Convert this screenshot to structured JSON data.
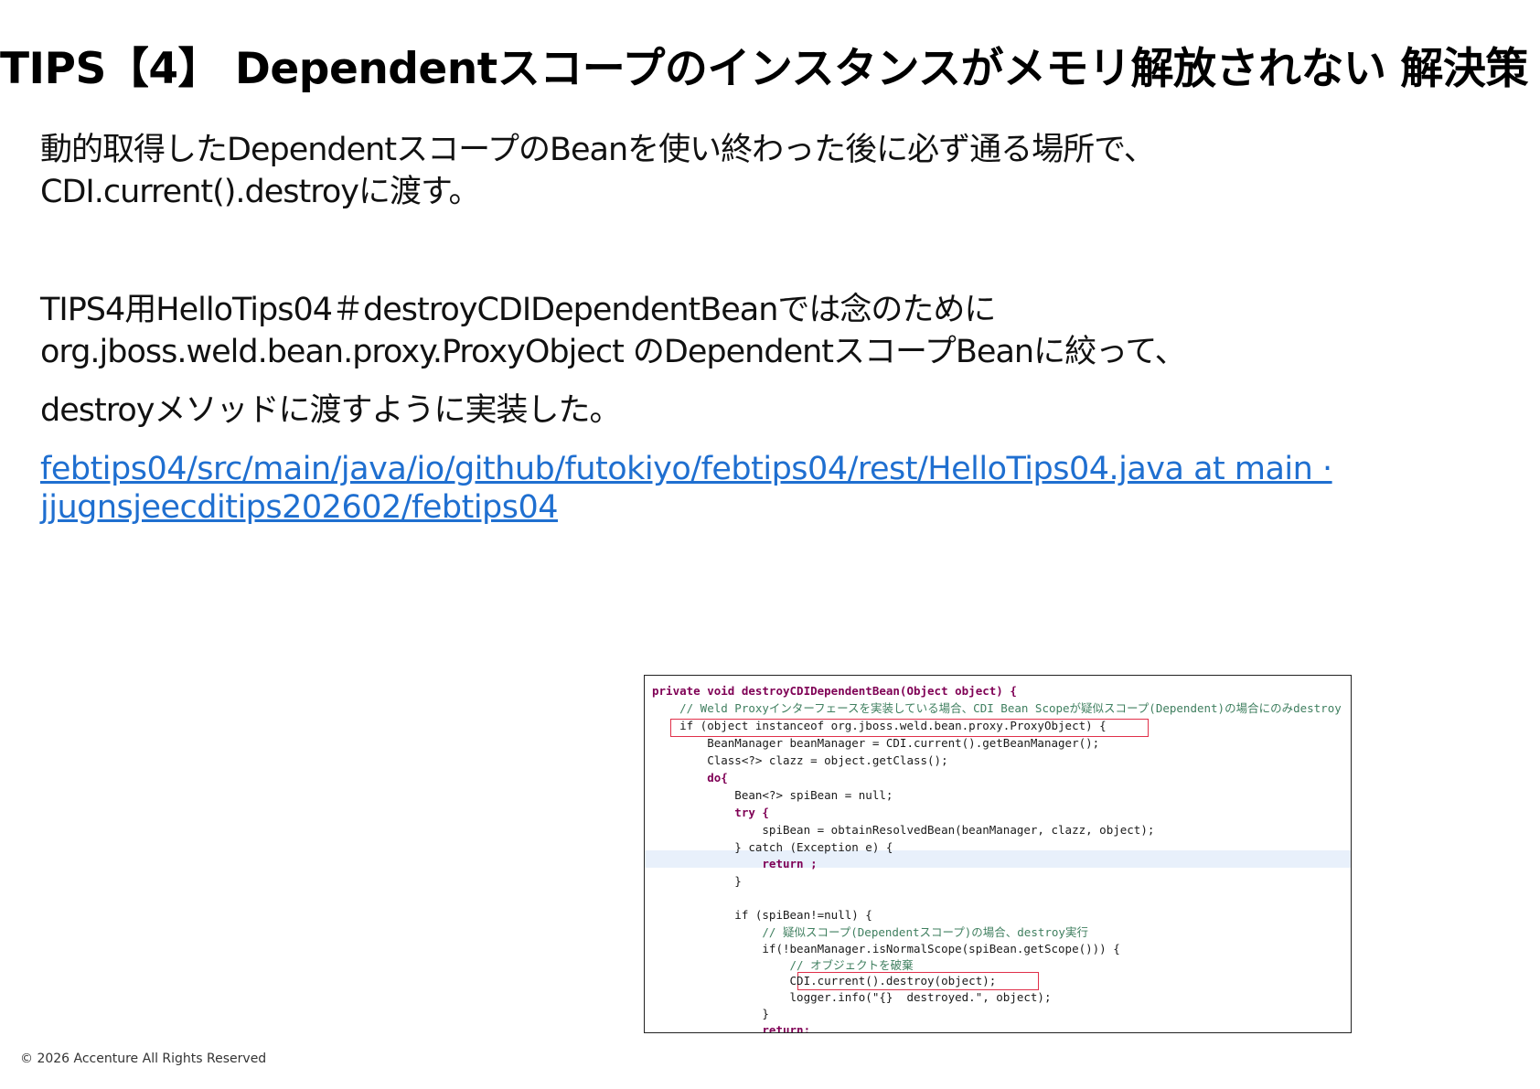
{
  "title": "TIPS【4】 Dependentスコープのインスタンスがメモリ解放されない 解決策",
  "paragraph1": {
    "line1": "動的取得したDependentスコープのBeanを使い終わった後に必ず通る場所で、",
    "line2": "CDI.current().destroyに渡す。"
  },
  "paragraph2": {
    "line1": "TIPS4用HelloTips04＃destroyCDIDependentBeanでは念のために",
    "line2": "org.jboss.weld.bean.proxy.ProxyObject のDependentスコープBeanに絞って、",
    "line3": "destroyメソッドに渡すように実装した。"
  },
  "link": {
    "line1": "febtips04/src/main/java/io/github/futokiyo/febtips04/rest/HelloTips04.java at main ·",
    "line2": "jjugnsjeecditips202602/febtips04"
  },
  "code_lines": [
    "private void destroyCDIDependentBean(Object object) {",
    "    // Weld Proxyインターフェースを実装している場合、CDI Bean Scopeが疑似スコープ(Dependent)の場合にのみdestroy",
    "    if (object instanceof org.jboss.weld.bean.proxy.ProxyObject) {",
    "        BeanManager beanManager = CDI.current().getBeanManager();",
    "        Class<?> clazz = object.getClass();",
    "        do{",
    "            Bean<?> spiBean = null;",
    "            try {",
    "                spiBean = obtainResolvedBean(beanManager, clazz, object);",
    "            } catch (Exception e) {",
    "                return ;",
    "            }",
    "",
    "            if (spiBean!=null) {",
    "                // 疑似スコープ(Dependentスコープ)の場合、destroy実行",
    "                if(!beanManager.isNormalScope(spiBean.getScope())) {",
    "                    // オブジェクトを破棄",
    "                    CDI.current().destroy(object);",
    "                    logger.info(\"{}  destroyed.\", object);",
    "                }",
    "                return;"
  ],
  "footer": "© 2026 Accenture All Rights Reserved"
}
